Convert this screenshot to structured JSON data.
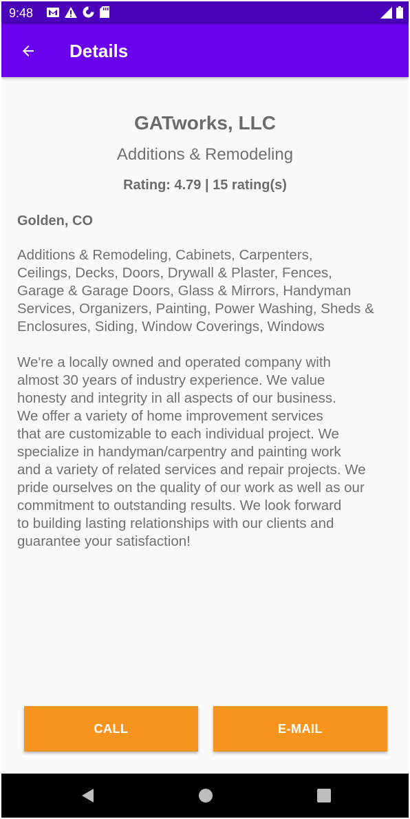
{
  "status_bar": {
    "time": "9:48",
    "left_icons": [
      "gmail-icon",
      "warning-icon",
      "data-saver-icon",
      "sd-card-icon"
    ],
    "right_icons": [
      "signal-icon",
      "battery-icon"
    ]
  },
  "app_bar": {
    "title": "Details",
    "back_icon": "arrow-back-icon"
  },
  "business": {
    "name": "GATworks, LLC",
    "category": "Additions & Remodeling",
    "rating_line": "Rating: 4.79 | 15 rating(s)",
    "location": "Golden, CO",
    "services": "Additions & Remodeling, Cabinets, Carpenters,\nCeilings, Decks, Doors, Drywall  & Plaster, Fences,\nGarage & Garage Doors, Glass & Mirrors, Handyman\nServices, Organizers, Painting, Power Washing, Sheds &\nEnclosures, Siding, Window Coverings, Windows",
    "description": "We're a locally owned and operated company with\nalmost 30 years of industry experience. We value\nhonesty and integrity in all aspects of our business.\nWe offer a variety of home improvement services\nthat are customizable to each individual project. We\nspecialize in handyman/carpentry and painting work\nand a variety of related services and repair projects. We\npride ourselves on the quality of our work as well as our\ncommitment to outstanding results. We look forward\nto building lasting relationships with our clients and\nguarantee your satisfaction!"
  },
  "actions": {
    "call_label": "CALL",
    "email_label": "E-MAIL"
  },
  "nav_bar": {
    "icons": [
      "nav-back-icon",
      "nav-home-icon",
      "nav-recents-icon"
    ]
  },
  "colors": {
    "status_bar": "#4a00b8",
    "app_bar": "#6a00ee",
    "button": "#f7941e",
    "text": "#707070",
    "nav_bar": "#000000"
  }
}
